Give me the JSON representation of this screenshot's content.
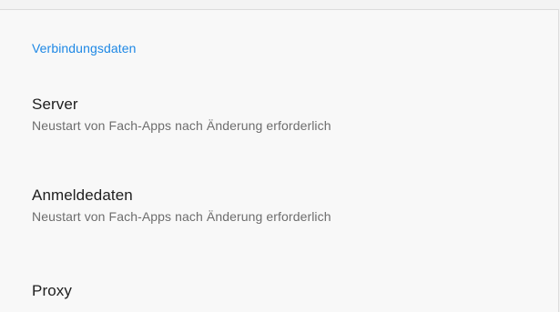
{
  "section": {
    "title": "Verbindungsdaten"
  },
  "items": [
    {
      "title": "Server",
      "summary": "Neustart von Fach-Apps nach Änderung erforderlich"
    },
    {
      "title": "Anmeldedaten",
      "summary": "Neustart von Fach-Apps nach Änderung erforderlich"
    },
    {
      "title": "Proxy"
    }
  ],
  "colors": {
    "accent": "#1e88e5",
    "title_text": "#202020",
    "summary_text": "#6d6d6d",
    "background": "#f8f8f8"
  }
}
